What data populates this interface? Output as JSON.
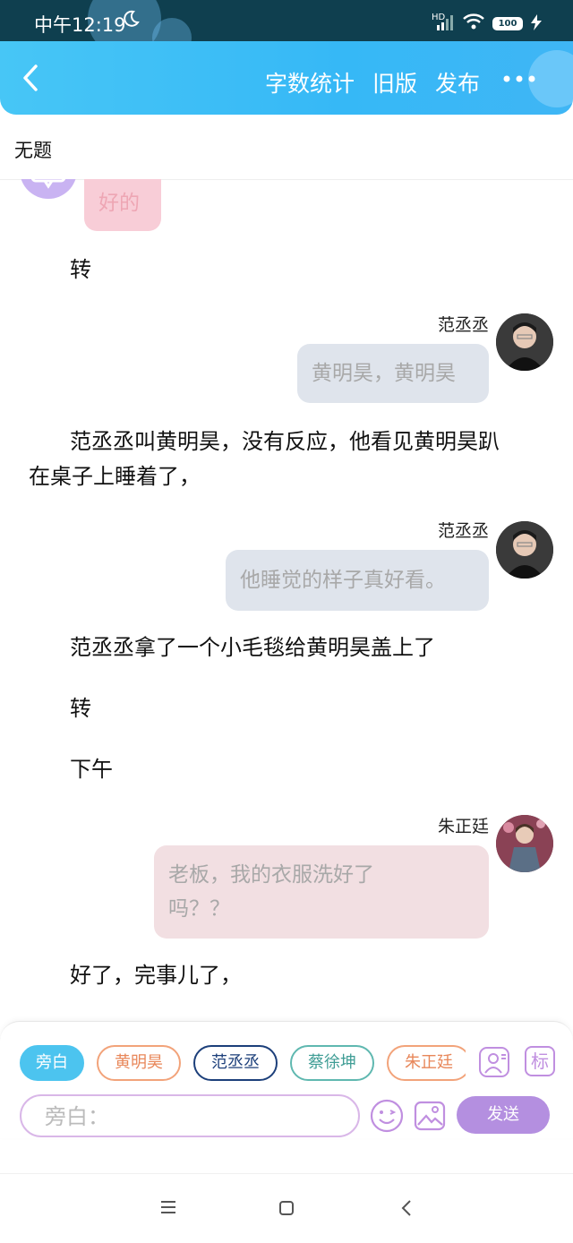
{
  "status_bar": {
    "time": "中午12:19",
    "hd": "HD",
    "battery": "100"
  },
  "header": {
    "back": "back",
    "word_count": "字数统计",
    "old_version": "旧版",
    "publish": "发布"
  },
  "title": "无题",
  "content": {
    "partial_reply": "好的",
    "narr_zhuan_1": "转",
    "msg1": {
      "name": "范丞丞",
      "text": "黄明昊，黄明昊"
    },
    "narr_long_line1": "范丞丞叫黄明昊，没有反应，他看见黄明昊趴",
    "narr_long_line2": "在桌子上睡着了，",
    "msg2": {
      "name": "范丞丞",
      "text": "他睡觉的样子真好看。"
    },
    "narr_blanket": "范丞丞拿了一个小毛毯给黄明昊盖上了",
    "narr_zhuan_2": "转",
    "narr_afternoon": "下午",
    "msg3": {
      "name": "朱正廷",
      "line1": "老板，我的衣服洗好了",
      "line2": "吗？？"
    },
    "narr_done": "好了，完事儿了，"
  },
  "roles": [
    "旁白",
    "黄明昊",
    "范丞丞",
    "蔡徐坤",
    "朱正廷"
  ],
  "composer": {
    "placeholder": "旁白：",
    "send": "发送",
    "tag_icon_label": "标"
  },
  "colors": {
    "accent": "#3bbdf6",
    "send": "#b48fe0",
    "narrator_chip": "#4cc4ef"
  }
}
